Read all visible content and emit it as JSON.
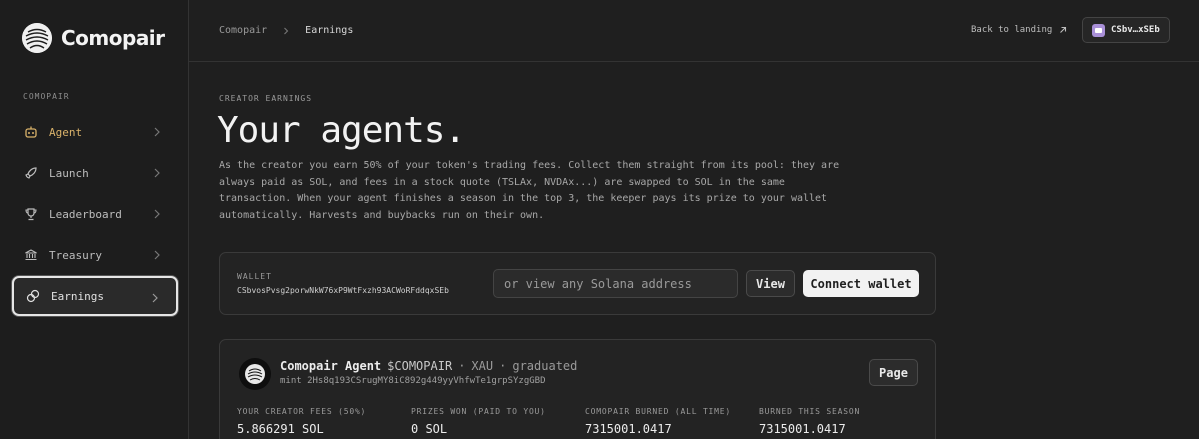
{
  "brand": {
    "name": "Comopair"
  },
  "sidebar": {
    "section_label": "COMOPAIR",
    "items": [
      {
        "label": "Agent",
        "icon": "robot-icon"
      },
      {
        "label": "Launch",
        "icon": "rocket-icon"
      },
      {
        "label": "Leaderboard",
        "icon": "trophy-icon"
      },
      {
        "label": "Treasury",
        "icon": "bank-icon"
      },
      {
        "label": "Earnings",
        "icon": "coins-icon",
        "active": true
      }
    ]
  },
  "header": {
    "breadcrumb": [
      "Comopair",
      "Earnings"
    ],
    "back_link": "Back to landing",
    "wallet_chip": "CSbv…xSEb"
  },
  "main": {
    "eyebrow": "CREATOR EARNINGS",
    "title": "Your agents.",
    "intro": "As the creator you earn 50% of your token's trading fees. Collect them straight from its pool: they are always paid as SOL, and fees in a stock quote (TSLAx, NVDAx...) are swapped to SOL in the same transaction. When your agent finishes a season in the top 3, the keeper pays its prize to your wallet automatically. Harvests and buybacks run on their own."
  },
  "wallet_card": {
    "label": "WALLET",
    "address": "CSbvosPvsg2porwNkW76xP9WtFxzh93ACWoRFddqxSEb",
    "input_placeholder": "or view any Solana address",
    "view_label": "View",
    "connect_label": "Connect wallet"
  },
  "agent": {
    "name": "Comopair Agent",
    "ticker": "$COMOPAIR",
    "quote": "XAU",
    "status": "graduated",
    "sep": "·",
    "mint": "mint 2Hs8q193CSrugMY8iC892g449yyVhfwTe1grpSYzgGBD",
    "page_label": "Page",
    "stats": [
      {
        "label": "YOUR CREATOR FEES (50%)",
        "value": "5.866291 SOL"
      },
      {
        "label": "PRIZES WON (PAID TO YOU)",
        "value": "0 SOL"
      },
      {
        "label": "COMOPAIR BURNED (ALL TIME)",
        "value": "7315001.0417"
      },
      {
        "label": "BURNED THIS SEASON",
        "value": "7315001.0417"
      }
    ]
  },
  "colors": {
    "accent_gold": "#d9b26a",
    "chip_purple": "#a990d8"
  }
}
